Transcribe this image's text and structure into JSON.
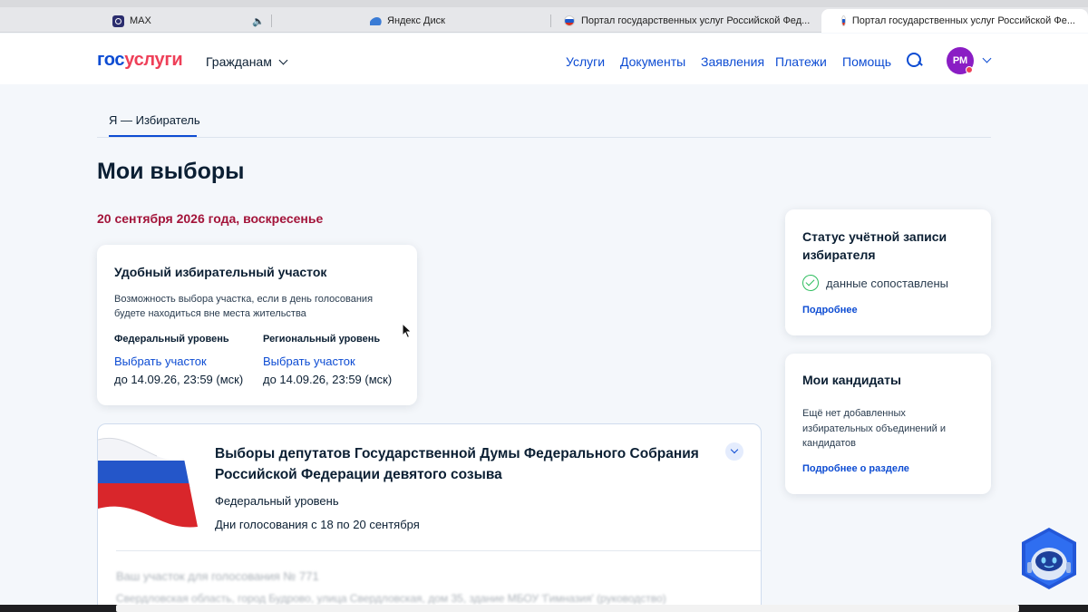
{
  "browser": {
    "tabs": [
      {
        "label": "MAX",
        "icon": "max-icon"
      },
      {
        "label": "",
        "icon": "speaker-icon"
      },
      {
        "label": "Яндекс Диск",
        "icon": "yandex-disk-icon"
      },
      {
        "label": "Портал государственных услуг Российской Фед...",
        "icon": "flag-icon"
      },
      {
        "label": "Портал государственных услуг Российской Фе...",
        "icon": "flag-icon",
        "active": true
      }
    ]
  },
  "header": {
    "logo_part1": "гос",
    "logo_part2": "услуги",
    "audience": "Гражданам",
    "nav": [
      "Услуги",
      "Документы",
      "Заявления",
      "Платежи",
      "Помощь"
    ],
    "avatar_initials": "РМ"
  },
  "subtab": "Я — Избиратель",
  "page_title": "Мои выборы",
  "election_date": "20 сентября 2026 года, воскресенье",
  "precinct_card": {
    "title": "Удобный избирательный участок",
    "description": "Возможность выбора участка, если в день голосования будете находиться вне места жительства",
    "federal": {
      "level": "Федеральный уровень",
      "link": "Выбрать участок",
      "deadline": "до 14.09.26, 23:59 (мск)"
    },
    "regional": {
      "level": "Региональный уровень",
      "link": "Выбрать участок",
      "deadline": "до 14.09.26, 23:59 (мск)"
    }
  },
  "election_card": {
    "title": "Выборы депутатов Государственной Думы Федерального Собрания Российской Федерации девятого созыва",
    "level": "Федеральный уровень",
    "voting_days": "Дни голосования с 18 по 20 сентября",
    "blurred_line1": "Ваш участок для голосования № 771",
    "blurred_line2": "Свердловская область, город Будрово, улица Свердловская, дом 35, здание МБОУ 'Гимназия' (руководство)"
  },
  "status_card": {
    "title": "Статус учётной записи избирателя",
    "status": "данные сопоставлены",
    "more": "Подробнее",
    "status_color": "#2dbd5e"
  },
  "candidates_card": {
    "title": "Мои кандидаты",
    "description": "Ещё нет добавленных избирательных объединений и кандидатов",
    "more": "Подробнее о разделе"
  },
  "colors": {
    "accent": "#0d4cd3",
    "date": "#a3143a",
    "logo_red": "#ee3f58",
    "avatar": "#8a1dc4"
  }
}
